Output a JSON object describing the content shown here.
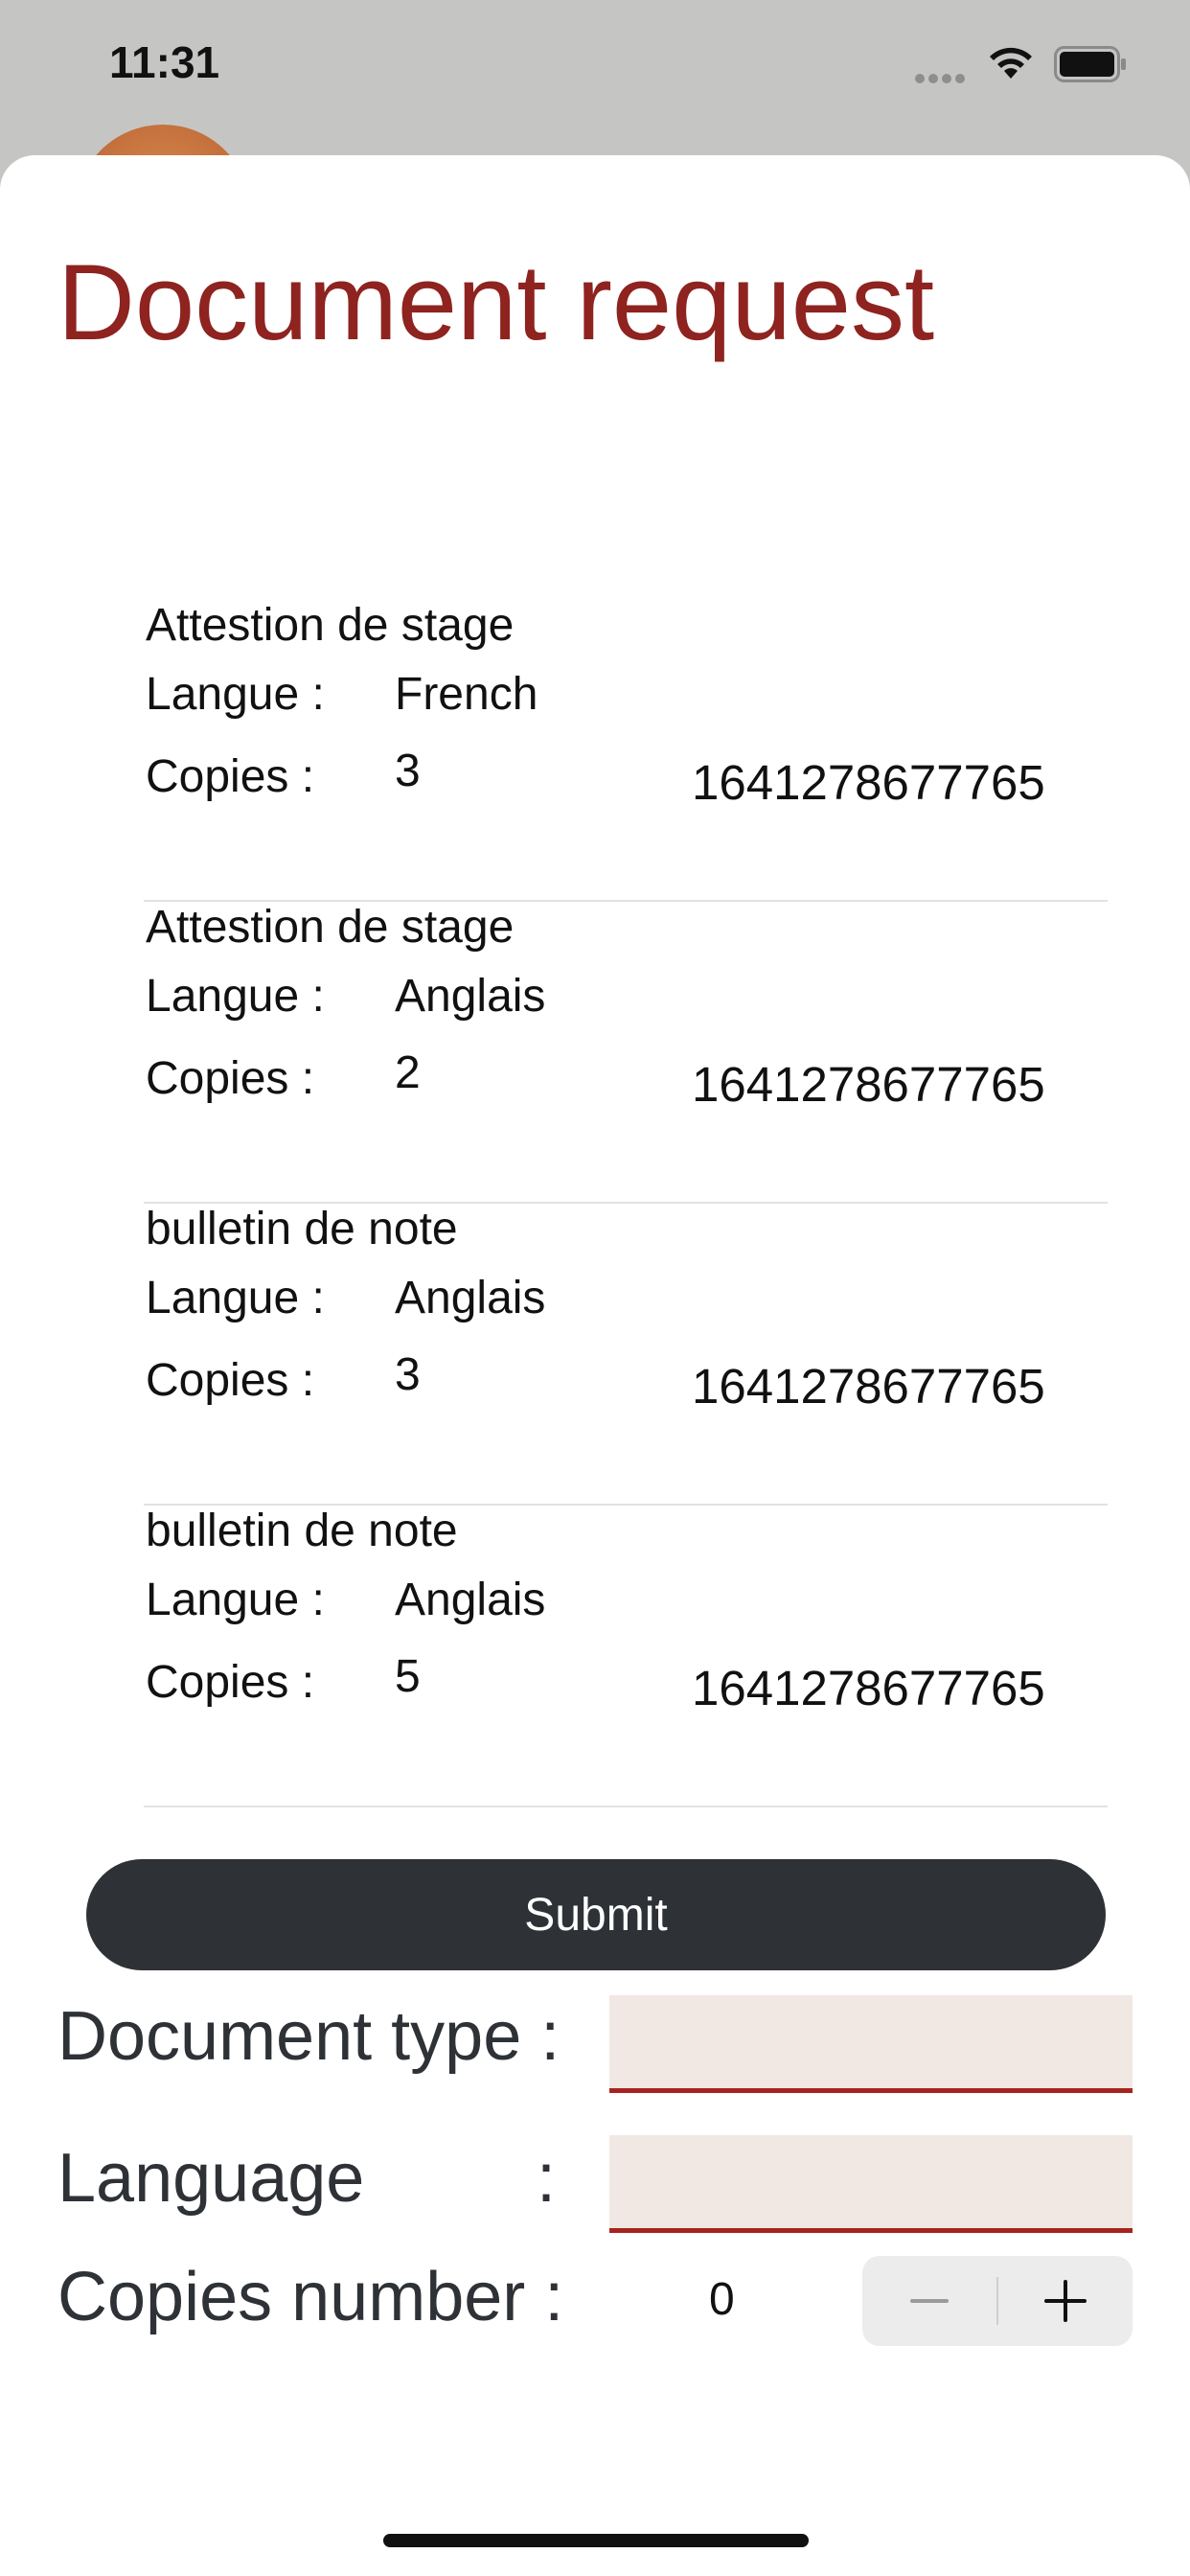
{
  "status_bar": {
    "time": "11:31"
  },
  "page": {
    "title": "Document request"
  },
  "requests": [
    {
      "document": "Attestion de stage",
      "langue_label": "Langue :",
      "langue": "French",
      "copies_label": "Copies  :",
      "copies": "3",
      "id": "1641278677765"
    },
    {
      "document": "Attestion de stage",
      "langue_label": "Langue :",
      "langue": "Anglais",
      "copies_label": "Copies  :",
      "copies": "2",
      "id": "1641278677765"
    },
    {
      "document": "bulletin de note",
      "langue_label": "Langue :",
      "langue": "Anglais",
      "copies_label": "Copies  :",
      "copies": "3",
      "id": "1641278677765"
    },
    {
      "document": "bulletin de note",
      "langue_label": "Langue :",
      "langue": "Anglais",
      "copies_label": "Copies  :",
      "copies": "5",
      "id": "1641278677765"
    }
  ],
  "form": {
    "submit_label": "Submit",
    "document_type_label": "Document type :",
    "document_type_value": "",
    "language_label": "Language",
    "language_colon": ":",
    "language_value": "",
    "copies_number_label": "Copies number :",
    "copies_number_value": "0"
  },
  "colors": {
    "accent": "#8e2320",
    "button_dark": "#2e3236",
    "input_bg": "#f1e8e3",
    "input_underline": "#a8231e"
  },
  "icons": {
    "signal": "signal-dots-icon",
    "wifi": "wifi-icon",
    "battery": "battery-icon",
    "minus": "minus-icon",
    "plus": "plus-icon"
  }
}
